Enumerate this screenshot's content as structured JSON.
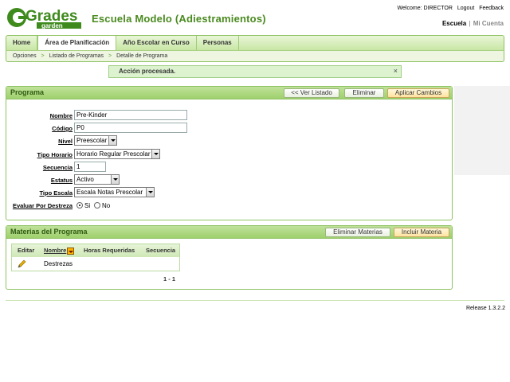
{
  "logo": {
    "text": "Grades",
    "subtext": "garden"
  },
  "header": {
    "title": "Escuela Modelo (Adiestramientos)",
    "welcome": "Welcome: DIRECTOR",
    "logout": "Logout",
    "feedback": "Feedback",
    "school_current": "Escuela",
    "school_separator": "|",
    "school_other": "Mi Cuenta"
  },
  "nav": {
    "tabs": [
      {
        "label": "Home"
      },
      {
        "label": "Área de Planificación"
      },
      {
        "label": "Año Escolar en Curso"
      },
      {
        "label": "Personas"
      }
    ],
    "active": "Área de Planificación"
  },
  "breadcrumb": {
    "items": [
      "Opciones",
      "Listado de Programas",
      "Detalle de Programa"
    ],
    "arrow": ">"
  },
  "message": {
    "text": "Acción procesada.",
    "close": "×"
  },
  "programa": {
    "title": "Programa",
    "btn_list": "<< Ver Listado",
    "btn_delete": "Eliminar",
    "btn_apply": "Aplicar Cambios",
    "fields": {
      "nombre_label": "Nombre",
      "nombre_value": "Pre-Kinder",
      "codigo_label": "Código",
      "codigo_value": "P0",
      "nivel_label": "Nivel",
      "nivel_value": "Preescolar",
      "tipo_horario_label": "Tipo Horario",
      "tipo_horario_value": "Horario Regular Prescolar",
      "secuencia_label": "Secuencia",
      "secuencia_value": "1",
      "estatus_label": "Estatus",
      "estatus_value": "Activo",
      "tipo_escala_label": "Tipo Escala",
      "tipo_escala_value": "Escala Notas Prescolar",
      "destreza_label": "Evaluar Por Destreza",
      "destreza_yes": "Si",
      "destreza_no": "No"
    }
  },
  "materias": {
    "title": "Materias del Programa",
    "btn_delete": "Eliminar Materias",
    "btn_add": "Incluir Materia",
    "columns": [
      "Editar",
      "Nombre",
      "Horas Requeridas",
      "Secuencia"
    ],
    "rows": [
      {
        "nombre": "Destrezas",
        "horas": "",
        "secuencia": ""
      }
    ],
    "pager": "1 - 1"
  },
  "footer": {
    "release": "Release 1.3.2.2"
  },
  "colors": {
    "accent": "#4a8a1f",
    "header_green": "#9fd06c",
    "border": "#8fc263"
  }
}
